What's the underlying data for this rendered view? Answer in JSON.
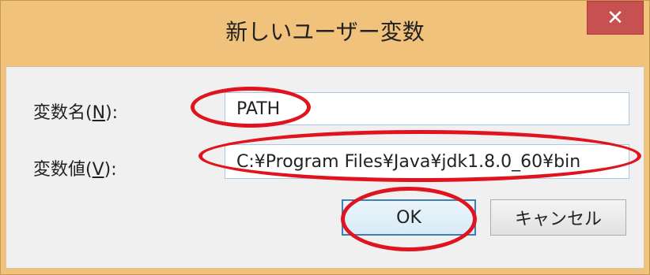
{
  "window": {
    "title": "新しいユーザー変数",
    "close_label": "✕"
  },
  "fields": {
    "name": {
      "label": "変数名(",
      "accesskey": "N",
      "label_suffix": "):",
      "value": "PATH"
    },
    "value": {
      "label": "変数値(",
      "accesskey": "V",
      "label_suffix": "):",
      "value": "C:¥Program Files¥Java¥jdk1.8.0_60¥bin"
    }
  },
  "buttons": {
    "ok_label": "OK",
    "cancel_label": "キャンセル"
  },
  "colors": {
    "frame": "#f1c27c",
    "close_button": "#c75050",
    "highlight_ring": "#e0141e"
  }
}
